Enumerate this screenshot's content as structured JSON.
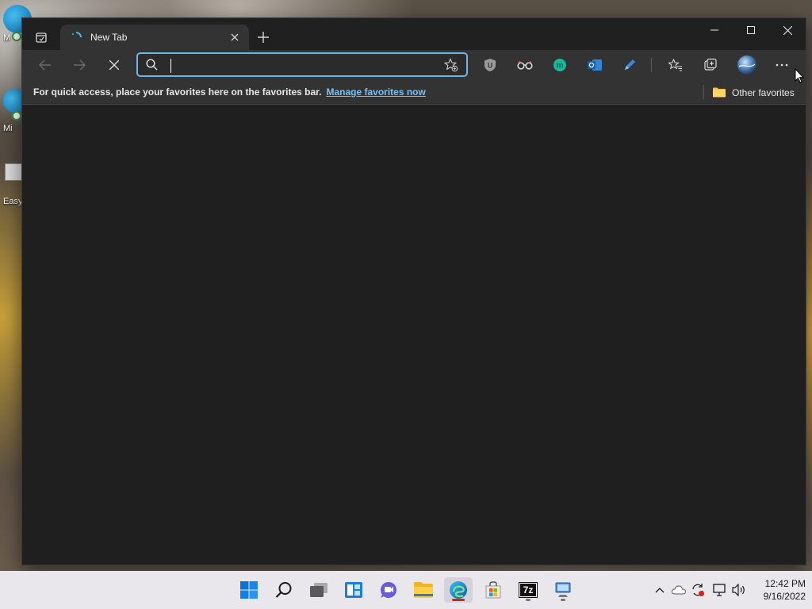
{
  "desktop": {
    "icons": [
      {
        "label": "M"
      },
      {
        "label": "Mi"
      },
      {
        "label": "Easy"
      }
    ]
  },
  "browser": {
    "tab": {
      "title": "New Tab"
    },
    "address_bar": {
      "value": "",
      "placeholder": ""
    },
    "favorites_bar": {
      "message": "For quick access, place your favorites here on the favorites bar.",
      "manage_link": "Manage favorites now",
      "other_favorites": "Other favorites"
    },
    "extension_icons": [
      "ublock-icon",
      "reader-glasses-icon",
      "m-extension-icon",
      "outlook-icon",
      "pen-tool-icon"
    ],
    "colors": {
      "accent": "#6fb7e9",
      "link": "#7cc0f5",
      "toolbar": "#333333",
      "content": "#1f1f1f"
    }
  },
  "taskbar": {
    "apps": [
      "windows-start-icon",
      "search-icon",
      "task-view-icon",
      "widgets-icon",
      "teams-chat-icon",
      "file-explorer-icon",
      "edge-icon",
      "store-icon",
      "7zip-icon",
      "remote-desktop-icon"
    ],
    "app_text": {
      "sevenzip": "7z"
    },
    "clock": {
      "time": "12:42 PM",
      "date": "9/16/2022"
    }
  }
}
